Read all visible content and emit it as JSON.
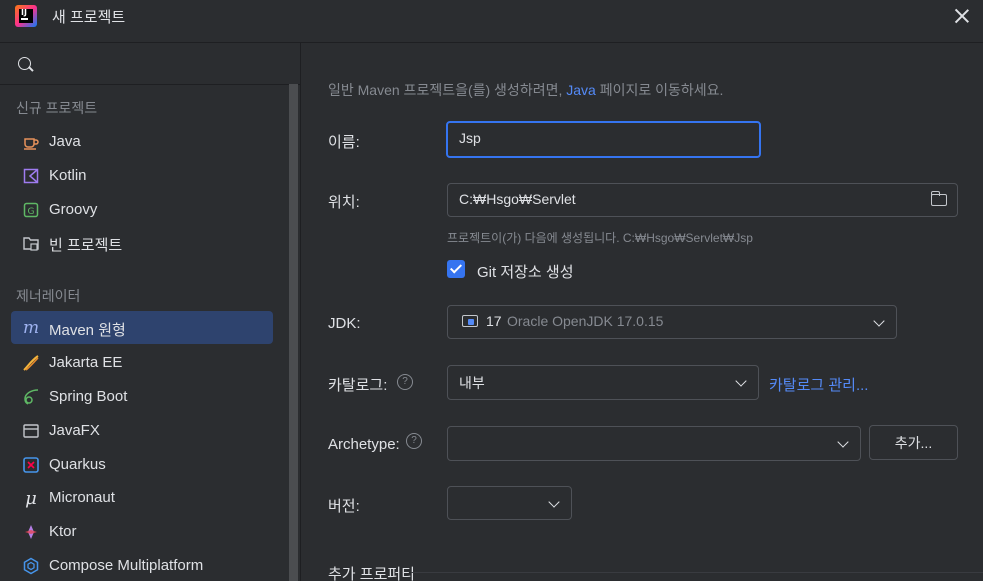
{
  "window": {
    "title": "새 프로젝트"
  },
  "sidebar": {
    "groups": [
      {
        "header": "신규 프로젝트",
        "items": [
          {
            "label": "Java",
            "icon": "java-cup-icon"
          },
          {
            "label": "Kotlin",
            "icon": "kotlin-icon"
          },
          {
            "label": "Groovy",
            "icon": "groovy-icon"
          },
          {
            "label": "빈 프로젝트",
            "icon": "empty-project-icon"
          }
        ]
      },
      {
        "header": "제너레이터",
        "items": [
          {
            "label": "Maven 원형",
            "icon": "maven-icon",
            "selected": true
          },
          {
            "label": "Jakarta EE",
            "icon": "jakarta-icon"
          },
          {
            "label": "Spring Boot",
            "icon": "spring-icon"
          },
          {
            "label": "JavaFX",
            "icon": "javafx-icon"
          },
          {
            "label": "Quarkus",
            "icon": "quarkus-icon"
          },
          {
            "label": "Micronaut",
            "icon": "micronaut-icon"
          },
          {
            "label": "Ktor",
            "icon": "ktor-icon"
          },
          {
            "label": "Compose Multiplatform",
            "icon": "compose-icon"
          }
        ]
      }
    ]
  },
  "main": {
    "hint_prefix": "일반 Maven 프로젝트을(를) 생성하려면,",
    "hint_link": "Java",
    "hint_suffix": "페이지로 이동하세요.",
    "name_label": "이름:",
    "name_value": "Jsp",
    "location_label": "위치:",
    "location_value": "C:₩Hsgo₩Servlet",
    "location_hint": "프로젝트이(가) 다음에 생성됩니다. C:₩Hsgo₩Servlet₩Jsp",
    "git_label": "Git 저장소 생성",
    "git_checked": true,
    "jdk_label": "JDK:",
    "jdk_version": "17",
    "jdk_name": "Oracle OpenJDK 17.0.15",
    "catalog_label": "카탈로그:",
    "catalog_value": "내부",
    "catalog_manage": "카탈로그 관리...",
    "archetype_label": "Archetype:",
    "archetype_value": "",
    "add_button": "추가...",
    "version_label": "버전:",
    "version_value": "",
    "advanced_section": "추가 프로퍼티",
    "help_glyph": "?"
  },
  "colors": {
    "accent": "#3574f0",
    "link": "#548af7",
    "selection": "#2e436e",
    "background": "#2b2d30"
  }
}
